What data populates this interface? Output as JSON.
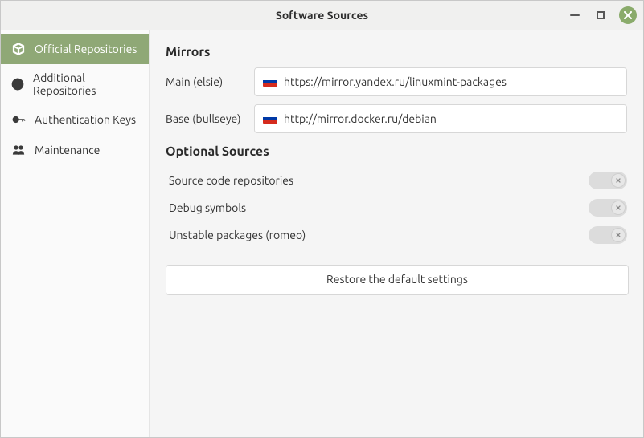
{
  "window": {
    "title": "Software Sources"
  },
  "sidebar": {
    "items": [
      {
        "label": "Official Repositories"
      },
      {
        "label": "Additional Repositories"
      },
      {
        "label": "Authentication Keys"
      },
      {
        "label": "Maintenance"
      }
    ]
  },
  "main": {
    "mirrors_heading": "Mirrors",
    "mirrors": [
      {
        "label": "Main (elsie)",
        "flag": "ru",
        "url": "https://mirror.yandex.ru/linuxmint-packages"
      },
      {
        "label": "Base (bullseye)",
        "flag": "ru",
        "url": "http://mirror.docker.ru/debian"
      }
    ],
    "optional_heading": "Optional Sources",
    "optional": [
      {
        "label": "Source code repositories",
        "enabled": false
      },
      {
        "label": "Debug symbols",
        "enabled": false
      },
      {
        "label": "Unstable packages (romeo)",
        "enabled": false
      }
    ],
    "restore_label": "Restore the default settings"
  }
}
